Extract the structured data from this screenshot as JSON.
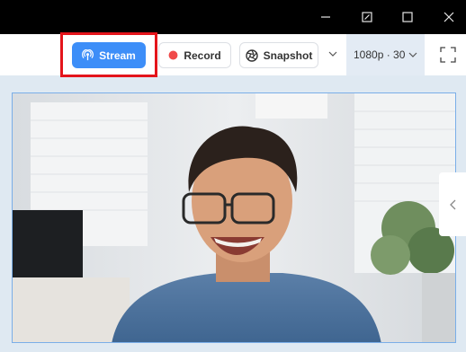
{
  "window_controls": {
    "minimize": "minimize",
    "restore": "restore",
    "maximize": "maximize",
    "close": "close"
  },
  "toolbar": {
    "stream_label": "Stream",
    "record_label": "Record",
    "snapshot_label": "Snapshot",
    "resolution": "1080p · 30"
  },
  "colors": {
    "accent": "#3d8ef8",
    "record_dot": "#f04a4a",
    "highlight": "#e4141b",
    "titlebar": "#000000"
  },
  "icons": [
    "broadcast-icon",
    "record-dot-icon",
    "camera-aperture-icon",
    "chevron-down-icon",
    "fullscreen-icon",
    "chevron-left-icon"
  ]
}
